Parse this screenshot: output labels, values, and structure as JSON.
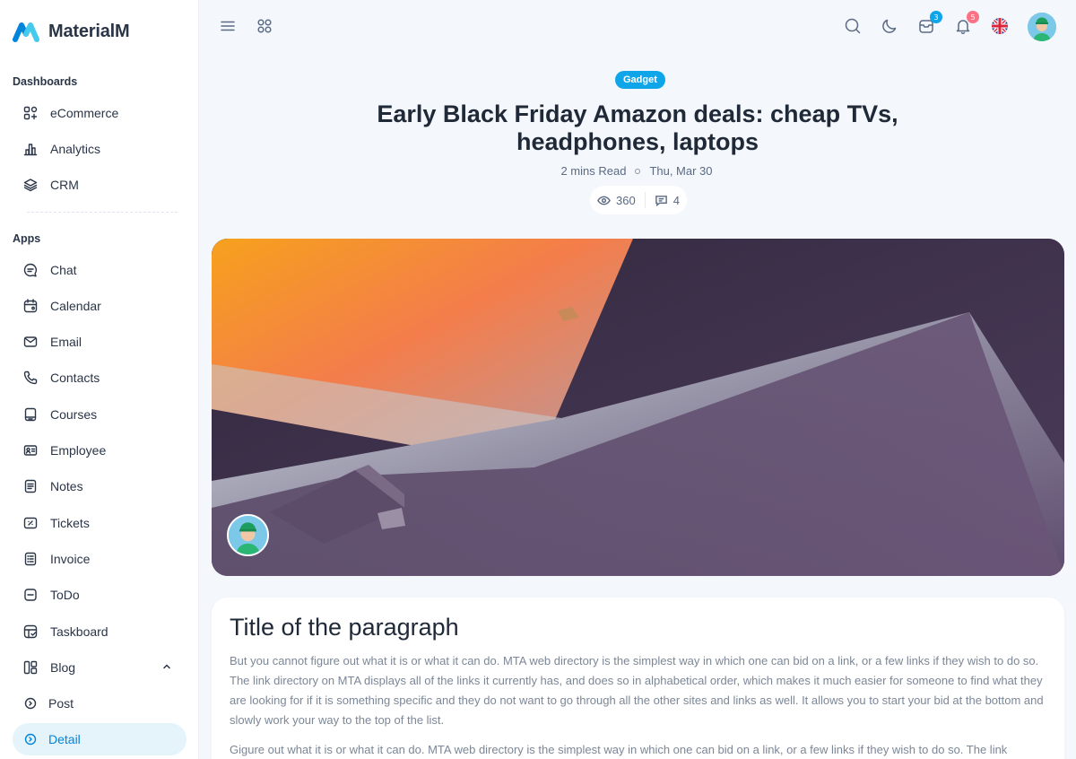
{
  "app": {
    "name": "MaterialM"
  },
  "sidebar": {
    "sections": [
      {
        "title": "Dashboards"
      },
      {
        "title": "Apps"
      }
    ],
    "dashboards": [
      {
        "label": "eCommerce",
        "icon": "apps-grid-icon"
      },
      {
        "label": "Analytics",
        "icon": "bar-chart-icon"
      },
      {
        "label": "CRM",
        "icon": "layers-icon"
      }
    ],
    "apps": [
      {
        "label": "Chat",
        "icon": "chat-bubble-icon"
      },
      {
        "label": "Calendar",
        "icon": "calendar-icon"
      },
      {
        "label": "Email",
        "icon": "mail-icon"
      },
      {
        "label": "Contacts",
        "icon": "phone-icon"
      },
      {
        "label": "Courses",
        "icon": "book-icon"
      },
      {
        "label": "Employee",
        "icon": "id-card-icon"
      },
      {
        "label": "Notes",
        "icon": "notes-icon"
      },
      {
        "label": "Tickets",
        "icon": "ticket-icon"
      },
      {
        "label": "Invoice",
        "icon": "invoice-icon"
      },
      {
        "label": "ToDo",
        "icon": "todo-icon"
      },
      {
        "label": "Taskboard",
        "icon": "taskboard-icon"
      },
      {
        "label": "Blog",
        "icon": "blog-icon"
      },
      {
        "label": "Post",
        "icon": "circle-dot-icon"
      },
      {
        "label": "Detail",
        "icon": "circle-dot-icon",
        "active": true
      }
    ]
  },
  "topbar": {
    "icons": [
      "menu-icon",
      "apps-icon",
      "search-icon",
      "moon-icon",
      "inbox-icon",
      "bell-icon",
      "flag-uk-icon",
      "user-avatar"
    ],
    "inbox_badge": "3",
    "notification_badge": "5",
    "badge_colors": {
      "inbox": "#0ea5e9",
      "notification": "#fb7185"
    }
  },
  "post": {
    "tag": "Gadget",
    "title": "Early Black Friday Amazon deals: cheap TVs, headphones, laptops",
    "read_time": "2 mins Read",
    "date": "Thu, Mar 30",
    "views": "360",
    "comments": "4"
  },
  "content": {
    "heading": "Title of the paragraph",
    "paragraph1": "But you cannot figure out what it is or what it can do. MTA web directory is the simplest way in which one can bid on a link, or a few links if they wish to do so. The link directory on MTA displays all of the links it currently has, and does so in alphabetical order, which makes it much easier for someone to find what they are looking for if it is something specific and they do not want to go through all the other sites and links as well. It allows you to start your bid at the bottom and slowly work your way to the top of the list.",
    "paragraph2": "Gigure out what it is or what it can do. MTA web directory is the simplest way in which one can bid on a link, or a few links if they wish to do so. The link"
  },
  "colors": {
    "accent": "#0085db",
    "active_bg": "#e5f3fb",
    "tag": "#0ea5e9"
  }
}
